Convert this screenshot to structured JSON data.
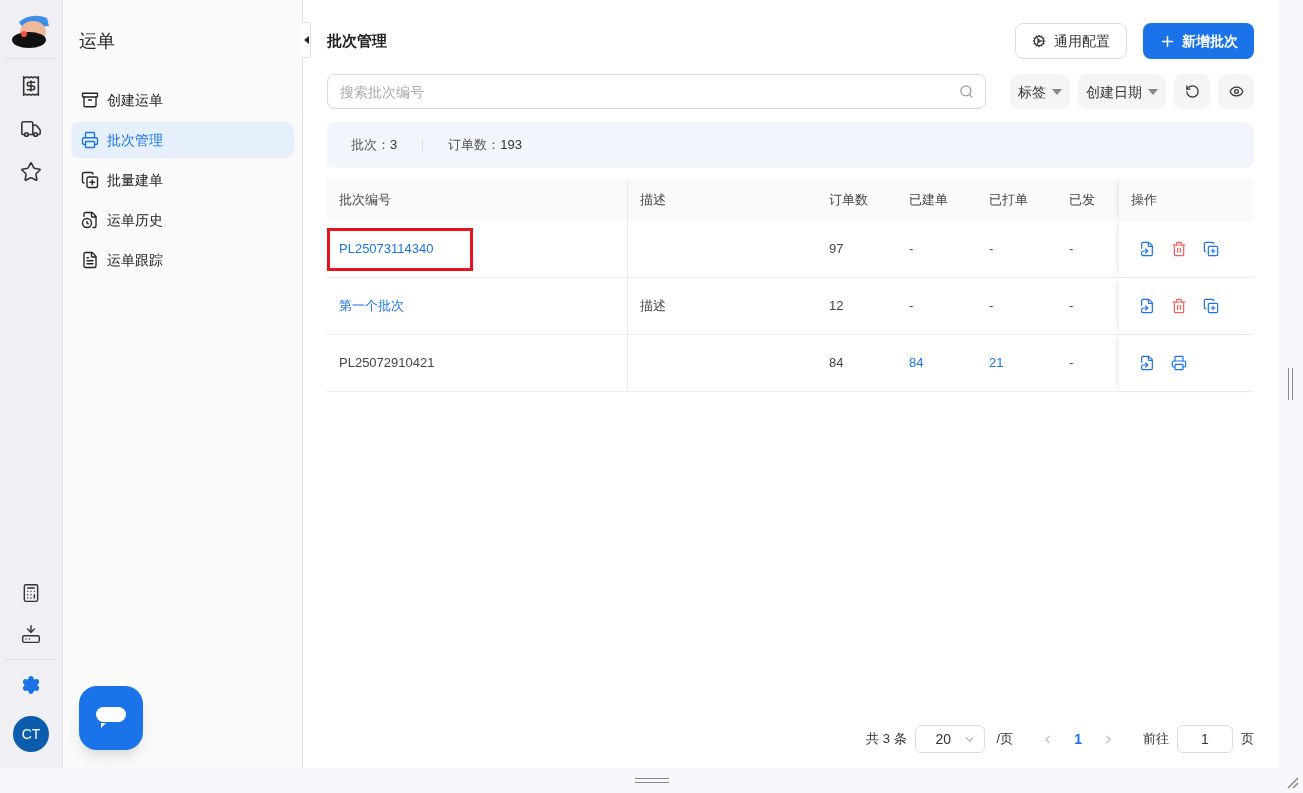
{
  "rail": {
    "items": [
      {
        "selected": false
      },
      {
        "selected": false
      },
      {
        "selected": false
      }
    ],
    "bottom_items": [
      {
        "selected": false
      },
      {
        "selected": false
      },
      {
        "selected": true
      }
    ],
    "avatar": "CT"
  },
  "sidebar": {
    "title": "运单",
    "items": [
      {
        "label": "创建运单",
        "selected": false
      },
      {
        "label": "批次管理",
        "selected": true
      },
      {
        "label": "批量建单",
        "selected": false
      },
      {
        "label": "运单历史",
        "selected": false
      },
      {
        "label": "运单跟踪",
        "selected": false
      }
    ]
  },
  "page": {
    "title": "批次管理",
    "config_button": "通用配置",
    "add_button": "新增批次"
  },
  "search": {
    "placeholder": "搜索批次编号"
  },
  "filters": [
    {
      "label": "标签"
    },
    {
      "label": "创建日期"
    }
  ],
  "summary": [
    {
      "label": "批次：",
      "value": "3"
    },
    {
      "label": "订单数：",
      "value": "193"
    }
  ],
  "table": {
    "columns": [
      "批次编号",
      "描述",
      "订单数",
      "已建单",
      "已打单",
      "已发",
      "操作"
    ],
    "rows": [
      {
        "highlighted": true,
        "batch_id": {
          "text": "PL25073114340",
          "link": true
        },
        "orders": {
          "text": "97",
          "link": false
        },
        "created": {
          "text": "-",
          "link": false
        },
        "printed": {
          "text": "-",
          "link": false
        },
        "shipped": {
          "text": "-",
          "link": false
        },
        "actions": [
          {
            "kind": "export"
          },
          {
            "kind": "delete"
          },
          {
            "kind": "copy"
          }
        ]
      },
      {
        "highlighted": false,
        "batch_id": {
          "text": "第一个批次",
          "link": true
        },
        "description": {
          "text": "描述",
          "link": false
        },
        "orders": {
          "text": "12",
          "link": false
        },
        "created": {
          "text": "-",
          "link": false
        },
        "printed": {
          "text": "-",
          "link": false
        },
        "shipped": {
          "text": "-",
          "link": false
        },
        "actions": [
          {
            "kind": "export"
          },
          {
            "kind": "delete"
          },
          {
            "kind": "copy"
          }
        ]
      },
      {
        "highlighted": false,
        "batch_id": {
          "text": "PL25072910421",
          "link": false
        },
        "orders": {
          "text": "84",
          "link": false
        },
        "created": {
          "text": "84",
          "link": true
        },
        "printed": {
          "text": "21",
          "link": true
        },
        "shipped": {
          "text": "-",
          "link": false
        },
        "actions": [
          {
            "kind": "export"
          },
          {
            "kind": "print"
          }
        ]
      }
    ]
  },
  "pagination": {
    "total": "共 3 条",
    "page_size": "20",
    "per_page": "/页",
    "pages": [
      {
        "label": "1",
        "selected": true
      }
    ],
    "goto_label": "前往",
    "goto_value": "1",
    "page_suffix": "页"
  }
}
